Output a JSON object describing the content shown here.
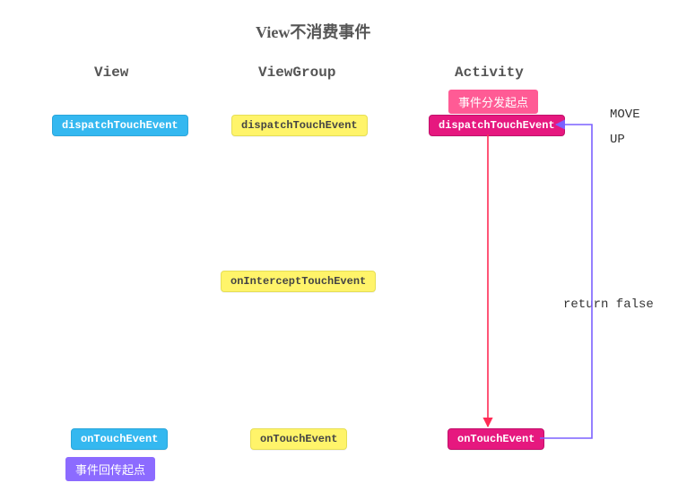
{
  "title": "View不消费事件",
  "columns": {
    "view": "View",
    "viewgroup": "ViewGroup",
    "activity": "Activity"
  },
  "badges": {
    "dispatch_start": "事件分发起点",
    "return_start": "事件回传起点"
  },
  "nodes": {
    "view_dispatch": "dispatchTouchEvent",
    "vg_dispatch": "dispatchTouchEvent",
    "act_dispatch": "dispatchTouchEvent",
    "vg_intercept": "onInterceptTouchEvent",
    "view_touch": "onTouchEvent",
    "vg_touch": "onTouchEvent",
    "act_touch": "onTouchEvent"
  },
  "labels": {
    "move": "MOVE",
    "up": "UP",
    "return_false": "return false"
  },
  "colors": {
    "blue": "#34b8f0",
    "yellow": "#fff46a",
    "pink": "#e6187f",
    "purple": "#8c6bff",
    "arrow_red": "#ff2a55",
    "arrow_purple": "#7b61ff"
  },
  "chart_data": {
    "type": "flow",
    "title": "View不消费事件",
    "columns": [
      "View",
      "ViewGroup",
      "Activity"
    ],
    "nodes": [
      {
        "id": "act_dispatch",
        "col": "Activity",
        "label": "dispatchTouchEvent",
        "color": "pink",
        "badge": "事件分发起点"
      },
      {
        "id": "vg_dispatch",
        "col": "ViewGroup",
        "label": "dispatchTouchEvent",
        "color": "yellow"
      },
      {
        "id": "view_dispatch",
        "col": "View",
        "label": "dispatchTouchEvent",
        "color": "blue"
      },
      {
        "id": "vg_intercept",
        "col": "ViewGroup",
        "label": "onInterceptTouchEvent",
        "color": "yellow"
      },
      {
        "id": "act_touch",
        "col": "Activity",
        "label": "onTouchEvent",
        "color": "pink"
      },
      {
        "id": "vg_touch",
        "col": "ViewGroup",
        "label": "onTouchEvent",
        "color": "yellow"
      },
      {
        "id": "view_touch",
        "col": "View",
        "label": "onTouchEvent",
        "color": "blue",
        "badge": "事件回传起点"
      }
    ],
    "edges": [
      {
        "from": "act_dispatch",
        "to": "act_touch",
        "color": "red",
        "label": "MOVE / UP"
      },
      {
        "from": "act_touch",
        "to": "act_dispatch",
        "color": "purple",
        "label": "return false"
      }
    ]
  }
}
